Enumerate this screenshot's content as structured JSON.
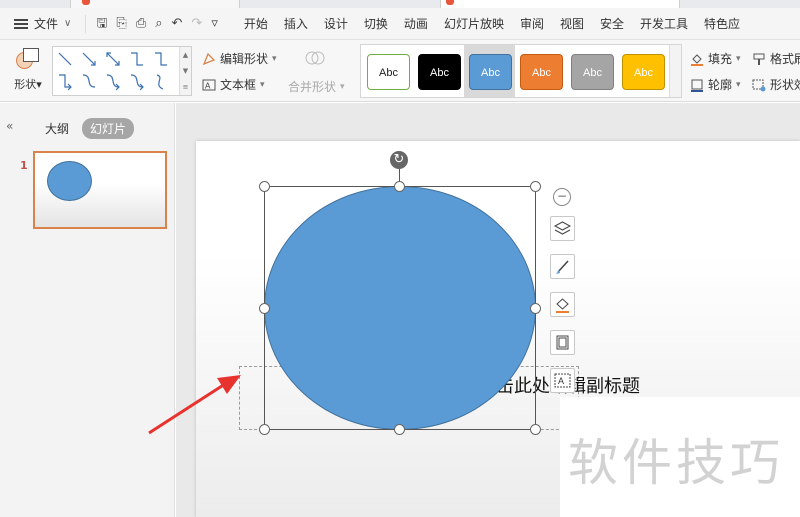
{
  "menubar": {
    "file_label": "文件",
    "tabs": [
      "开始",
      "插入",
      "设计",
      "切换",
      "动画",
      "幻灯片放映",
      "审阅",
      "视图",
      "安全",
      "开发工具",
      "特色应"
    ]
  },
  "ribbon": {
    "shape_label": "形状",
    "edit_shape_label": "编辑形状",
    "text_box_label": "文本框",
    "merge_shape_label": "合并形状",
    "style_presets": [
      {
        "label": "Abc",
        "bg": "#ffffff",
        "border": "#70ad47",
        "fg": "#222222"
      },
      {
        "label": "Abc",
        "bg": "#000000",
        "border": "#000000",
        "fg": "#ffffff"
      },
      {
        "label": "Abc",
        "bg": "#5b9bd5",
        "border": "#41719c",
        "fg": "#ffffff"
      },
      {
        "label": "Abc",
        "bg": "#ed7d31",
        "border": "#c55a11",
        "fg": "#ffffff"
      },
      {
        "label": "Abc",
        "bg": "#a5a5a5",
        "border": "#7f7f7f",
        "fg": "#ffffff"
      },
      {
        "label": "Abc",
        "bg": "#ffc000",
        "border": "#bf9000",
        "fg": "#ffffff"
      }
    ],
    "fill_label": "填充",
    "outline_label": "轮廓",
    "format_label": "格式刷",
    "shape_effect_label": "形状效"
  },
  "left_panel": {
    "outline_tab": "大纲",
    "slides_tab": "幻灯片",
    "slide_number": "1"
  },
  "slide": {
    "subtitle_text": "单击此处编辑副标题",
    "shape_fill": "#5b9bd5",
    "shape_border": "#41719c"
  },
  "watermark": "软件技巧"
}
